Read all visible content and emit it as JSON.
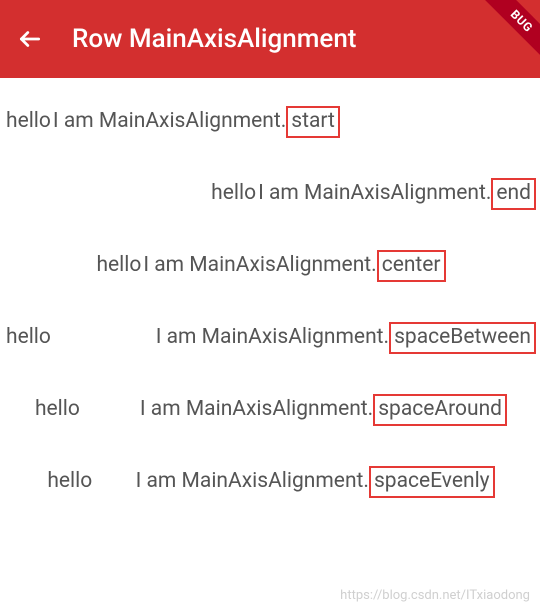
{
  "header": {
    "title": "Row MainAxisAlignment",
    "back_icon": "arrow-back",
    "debug_label": "BUG"
  },
  "rows": [
    {
      "alignment": "start",
      "hello": "hello",
      "prefix": "I am MainAxisAlignment.",
      "value": "start"
    },
    {
      "alignment": "end",
      "hello": "hello",
      "prefix": "I am MainAxisAlignment.",
      "value": "end"
    },
    {
      "alignment": "center",
      "hello": "hello",
      "prefix": "I am  MainAxisAlignment.",
      "value": "center"
    },
    {
      "alignment": "spaceBetween",
      "hello": "hello",
      "prefix": "I am MainAxisAlignment.",
      "value": "spaceBetween"
    },
    {
      "alignment": "spaceAround",
      "hello": "hello",
      "prefix": "I am MainAxisAlignment.",
      "value": "spaceAround"
    },
    {
      "alignment": "spaceEvenly",
      "hello": "hello",
      "prefix": "I am MainAxisAlignment.",
      "value": "spaceEvenly"
    }
  ],
  "watermark": "https://blog.csdn.net/ITxiaodong"
}
